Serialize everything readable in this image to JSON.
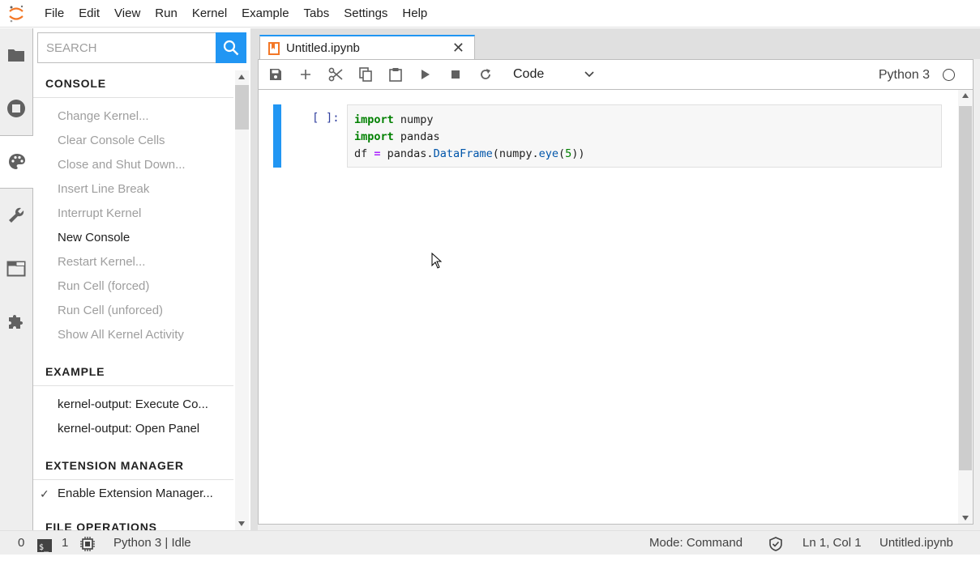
{
  "menu": [
    "File",
    "Edit",
    "View",
    "Run",
    "Kernel",
    "Example",
    "Tabs",
    "Settings",
    "Help"
  ],
  "left_sidebar_icons": [
    "folder-icon",
    "running-icon",
    "palette-icon",
    "wrench-icon",
    "tabs-icon",
    "extension-icon"
  ],
  "palette": {
    "search_placeholder": "SEARCH",
    "categories": [
      {
        "title": "CONSOLE",
        "items": [
          {
            "label": "Change Kernel...",
            "enabled": false
          },
          {
            "label": "Clear Console Cells",
            "enabled": false
          },
          {
            "label": "Close and Shut Down...",
            "enabled": false
          },
          {
            "label": "Insert Line Break",
            "enabled": false
          },
          {
            "label": "Interrupt Kernel",
            "enabled": false
          },
          {
            "label": "New Console",
            "enabled": true
          },
          {
            "label": "Restart Kernel...",
            "enabled": false
          },
          {
            "label": "Run Cell (forced)",
            "enabled": false
          },
          {
            "label": "Run Cell (unforced)",
            "enabled": false
          },
          {
            "label": "Show All Kernel Activity",
            "enabled": false
          }
        ]
      },
      {
        "title": "EXAMPLE",
        "items": [
          {
            "label": "kernel-output: Execute Co...",
            "enabled": true
          },
          {
            "label": "kernel-output: Open Panel",
            "enabled": true
          }
        ]
      },
      {
        "title": "EXTENSION MANAGER",
        "items": [
          {
            "label": "Enable Extension Manager...",
            "enabled": true,
            "checked": true
          }
        ]
      },
      {
        "title": "FILE OPERATIONS",
        "items": []
      }
    ]
  },
  "document_tab": {
    "title": "Untitled.ipynb",
    "close": "✕"
  },
  "toolbar": {
    "buttons": [
      "save-icon",
      "add-icon",
      "cut-icon",
      "copy-icon",
      "paste-icon",
      "run-icon",
      "stop-icon",
      "restart-icon"
    ],
    "cell_type": "Code",
    "kernel": "Python 3"
  },
  "cell": {
    "prompt": "[ ]:",
    "code_lines": [
      "import numpy",
      "import pandas",
      "df = pandas.DataFrame(numpy.eye(5))"
    ]
  },
  "status": {
    "terminals": "0",
    "kernels": "1",
    "kernel_status": "Python 3 | Idle",
    "mode": "Mode: Command",
    "position": "Ln 1, Col 1",
    "file": "Untitled.ipynb"
  },
  "colors": {
    "accent": "#2196f3",
    "logo": "#f37726"
  }
}
